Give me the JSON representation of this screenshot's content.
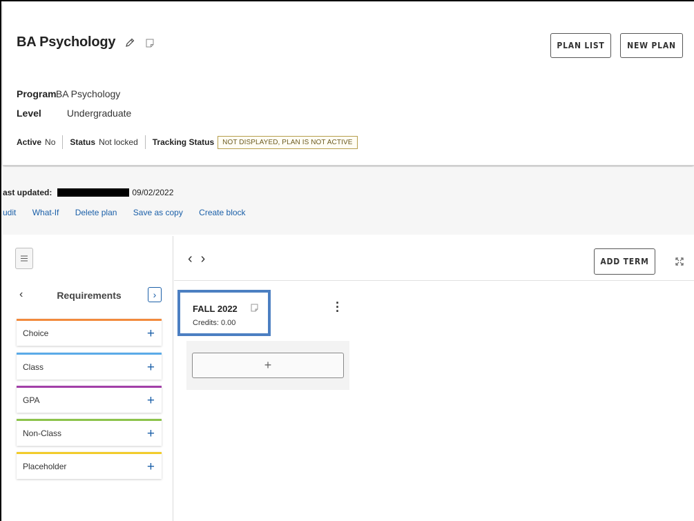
{
  "plan": {
    "title": "BA Psychology",
    "buttons": {
      "plan_list": "PLAN LIST",
      "new_plan": "NEW PLAN"
    },
    "program_label": "Program",
    "program_value": "BA Psychology",
    "level_label": "Level",
    "level_value": "Undergraduate",
    "active_label": "Active",
    "active_value": "No",
    "status_label": "Status",
    "status_value": "Not locked",
    "tracking_label": "Tracking Status",
    "tracking_value": "NOT DISPLAYED, PLAN IS NOT ACTIVE"
  },
  "meta": {
    "last_updated_label": "ast updated:",
    "last_updated_date": "09/02/2022",
    "links": [
      "udit",
      "What-If",
      "Delete plan",
      "Save as copy",
      "Create block"
    ]
  },
  "requirements": {
    "title": "Requirements",
    "items": [
      {
        "label": "Choice",
        "color": "#f28a3c"
      },
      {
        "label": "Class",
        "color": "#5aaae8"
      },
      {
        "label": "GPA",
        "color": "#a23fa8"
      },
      {
        "label": "Non-Class",
        "color": "#8cc34a"
      },
      {
        "label": "Placeholder",
        "color": "#f2cc2b"
      }
    ]
  },
  "terms": {
    "add_term": "ADD TERM",
    "items": [
      {
        "title": "FALL 2022",
        "credits": "Credits:  0.00"
      }
    ]
  },
  "colors": {
    "accent": "#1a5fa8",
    "highlight_border": "#4c7fc2"
  }
}
